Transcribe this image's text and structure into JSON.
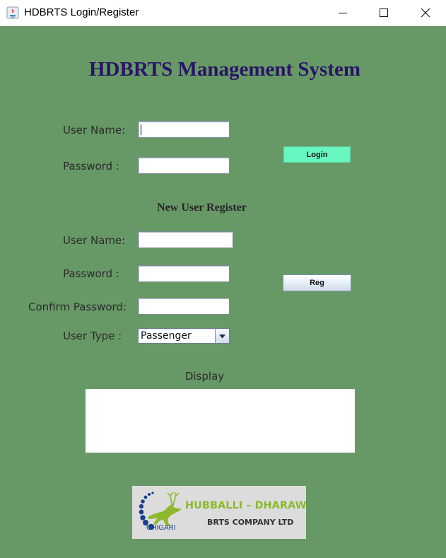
{
  "window": {
    "title": "HDBRTS Login/Register",
    "controls": {
      "minimize_icon": "minimize-icon",
      "maximize_icon": "maximize-icon",
      "close_icon": "close-icon"
    }
  },
  "header": {
    "title": "HDBRTS Management System"
  },
  "login": {
    "username_label": "User Name:",
    "username_value": "",
    "password_label": "Password  :",
    "password_value": "",
    "login_button": "Login"
  },
  "register": {
    "heading": "New User Register",
    "username_label": "User Name:",
    "username_value": "",
    "password_label": "Password  :",
    "password_value": "",
    "confirm_label": "Confirm Password:",
    "confirm_value": "",
    "usertype_label": "User Type :",
    "usertype_value": "Passenger",
    "reg_button": "Reg"
  },
  "display": {
    "label": "Display",
    "value": ""
  },
  "logo": {
    "line1": "HUBBALLI – DHARAWAD",
    "line2": "BRTS COMPANY LTD",
    "brand": "CHIGARI"
  },
  "colors": {
    "background": "#679966",
    "title": "#2a1466",
    "login_button": "#67f5c0"
  }
}
